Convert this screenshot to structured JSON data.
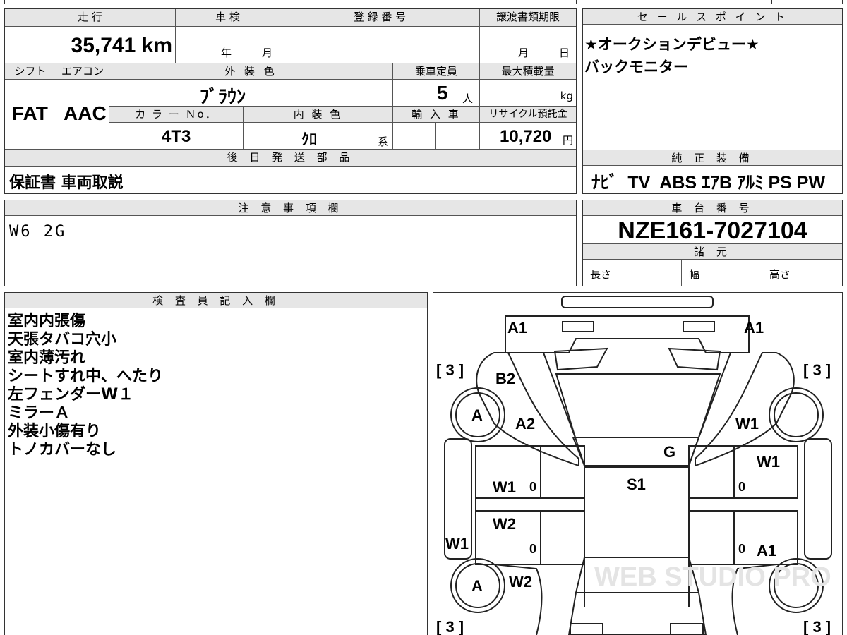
{
  "left_top": {
    "mileage_label": "走 行",
    "mileage_value": "35,741 km",
    "shaken_label": "車 検",
    "shaken_year": "年",
    "shaken_month": "月",
    "regno_label": "登 録 番 号",
    "deadline_label": "譲渡書類期限",
    "deadline_month": "月",
    "deadline_day": "日",
    "shift_label": "シフト",
    "ac_label": "エアコン",
    "ext_color_label": "外 装 色",
    "capacity_label": "乗車定員",
    "max_load_label": "最大積載量",
    "shift_value": "FAT",
    "ac_value": "AAC",
    "ext_color_value": "ﾌﾞﾗｳﾝ",
    "capacity_value": "5",
    "capacity_unit": "人",
    "load_unit": "kg",
    "color_no_label": "カ ラ ー Ｎo．",
    "int_color_label": "内 装 色",
    "import_label": "輸 入 車",
    "recycle_label": "リサイクル預託金",
    "color_no_value": "4T3",
    "int_color_value": "ｸﾛ",
    "int_color_unit": "系",
    "recycle_value": "10,720",
    "recycle_unit": "円",
    "later_parts_label": "後 日 発 送 部 品",
    "later_parts_value": "保証書 車両取説"
  },
  "sales_point": {
    "label": "セ ー ル ス ポ イ ン ト",
    "lines": [
      "★オークションデビュー★",
      "バックモニター"
    ]
  },
  "genuine_equipment": {
    "label": "純 正 装 備",
    "value": "ﾅﾋﾞ  TV  ABS ｴｱB ｱﾙﾐ PS PW"
  },
  "notes": {
    "label": "注 意 事 項 欄",
    "value": "W6 2G"
  },
  "chassis": {
    "label": "車 台 番 号",
    "value": "NZE161-7027104",
    "specs_label": "諸 元",
    "length_label": "長さ",
    "width_label": "幅",
    "height_label": "高さ"
  },
  "inspector": {
    "label": "検 査 員 記 入 欄",
    "lines": [
      "室内内張傷",
      "天張タバコ穴小",
      "室内薄汚れ",
      "シートすれ中、へたり",
      "左フェンダーW１",
      "ミラーＡ",
      "外装小傷有り",
      "トノカバーなし"
    ]
  },
  "diagram": {
    "marks": {
      "a1_left": "A1",
      "a1_right": "A1",
      "tire_fl": "[ 3 ]",
      "tire_fr": "[ 3 ]",
      "tire_rl": "[ 3 ]",
      "tire_rr": "[ 3 ]",
      "b2": "B2",
      "mirror_left": "A",
      "a2": "A2",
      "w1_fr_fender": "W1",
      "g": "G",
      "w1_fr_door": "W1",
      "w1_fl_door": "W1",
      "s1": "S1",
      "zero1": "0",
      "zero2": "0",
      "zero3": "0",
      "zero4": "0",
      "w2_rl_door": "W2",
      "w1_l_side": "W1",
      "a1_rr_door": "A1",
      "wheel_rl": "A",
      "w2_rl_fender": "W2"
    },
    "watermark": "WEB STUDIO PRO"
  }
}
